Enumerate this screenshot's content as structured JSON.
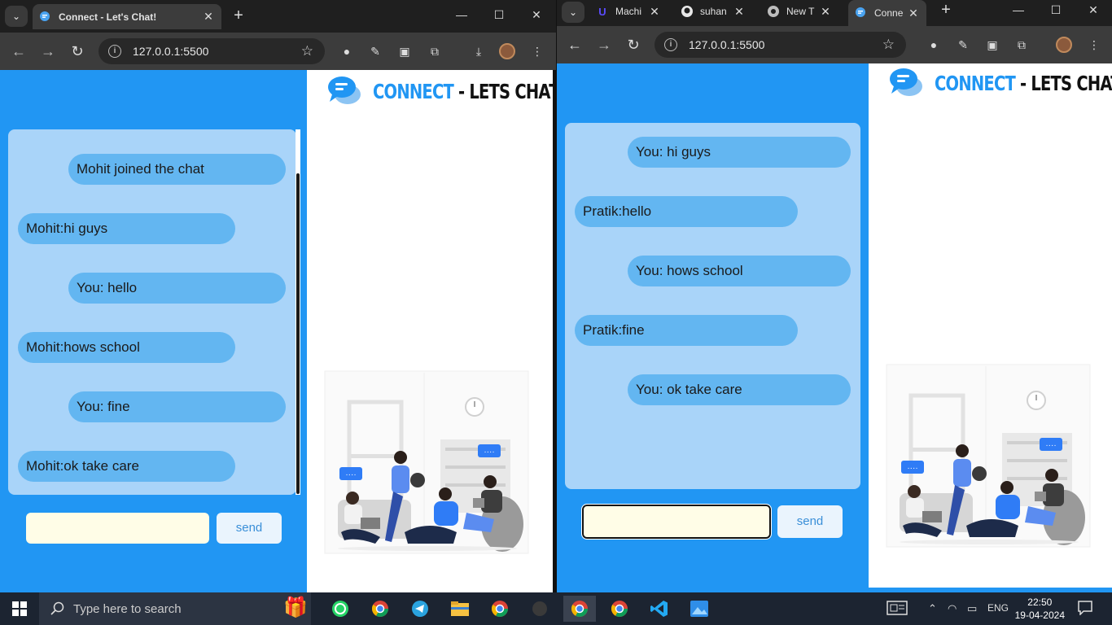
{
  "left_window": {
    "tab": {
      "title": "Connect - Let's Chat!"
    },
    "url": "127.0.0.1:5500",
    "logo": {
      "brand_a": "CONNECT",
      "brand_b": " - LETS CHAT!"
    },
    "messages": [
      {
        "text": "Mohit joined the chat",
        "side": "right"
      },
      {
        "text": "Mohit:hi guys",
        "side": "left"
      },
      {
        "text": "You: hello",
        "side": "right"
      },
      {
        "text": "Mohit:hows school",
        "side": "left"
      },
      {
        "text": "You: fine",
        "side": "right"
      },
      {
        "text": "Mohit:ok take care",
        "side": "left"
      }
    ],
    "input_value": "",
    "send_label": "send"
  },
  "right_window": {
    "tabs": [
      {
        "title": "Machi",
        "icon": "udemy-icon"
      },
      {
        "title": "suhan",
        "icon": "github-icon"
      },
      {
        "title": "New T",
        "icon": "chrome-icon"
      },
      {
        "title": "Conne",
        "icon": "chat-icon"
      }
    ],
    "url": "127.0.0.1:5500",
    "logo": {
      "brand_a": "CONNECT",
      "brand_b": " - LETS CHAT!"
    },
    "messages": [
      {
        "text": "You: hi guys",
        "side": "right"
      },
      {
        "text": "Pratik:hello",
        "side": "left"
      },
      {
        "text": "You: hows school",
        "side": "right"
      },
      {
        "text": "Pratik:fine",
        "side": "left"
      },
      {
        "text": "You: ok take care",
        "side": "right"
      }
    ],
    "input_value": "",
    "send_label": "send"
  },
  "taskbar": {
    "search_placeholder": "Type here to search",
    "language": "ENG",
    "time": "22:50",
    "date": "19-04-2024"
  },
  "colors": {
    "chat_blue": "#2196f3",
    "chat_box": "#a9d4f9",
    "bubble": "#63b6f1",
    "input_bg": "#fffde7"
  }
}
